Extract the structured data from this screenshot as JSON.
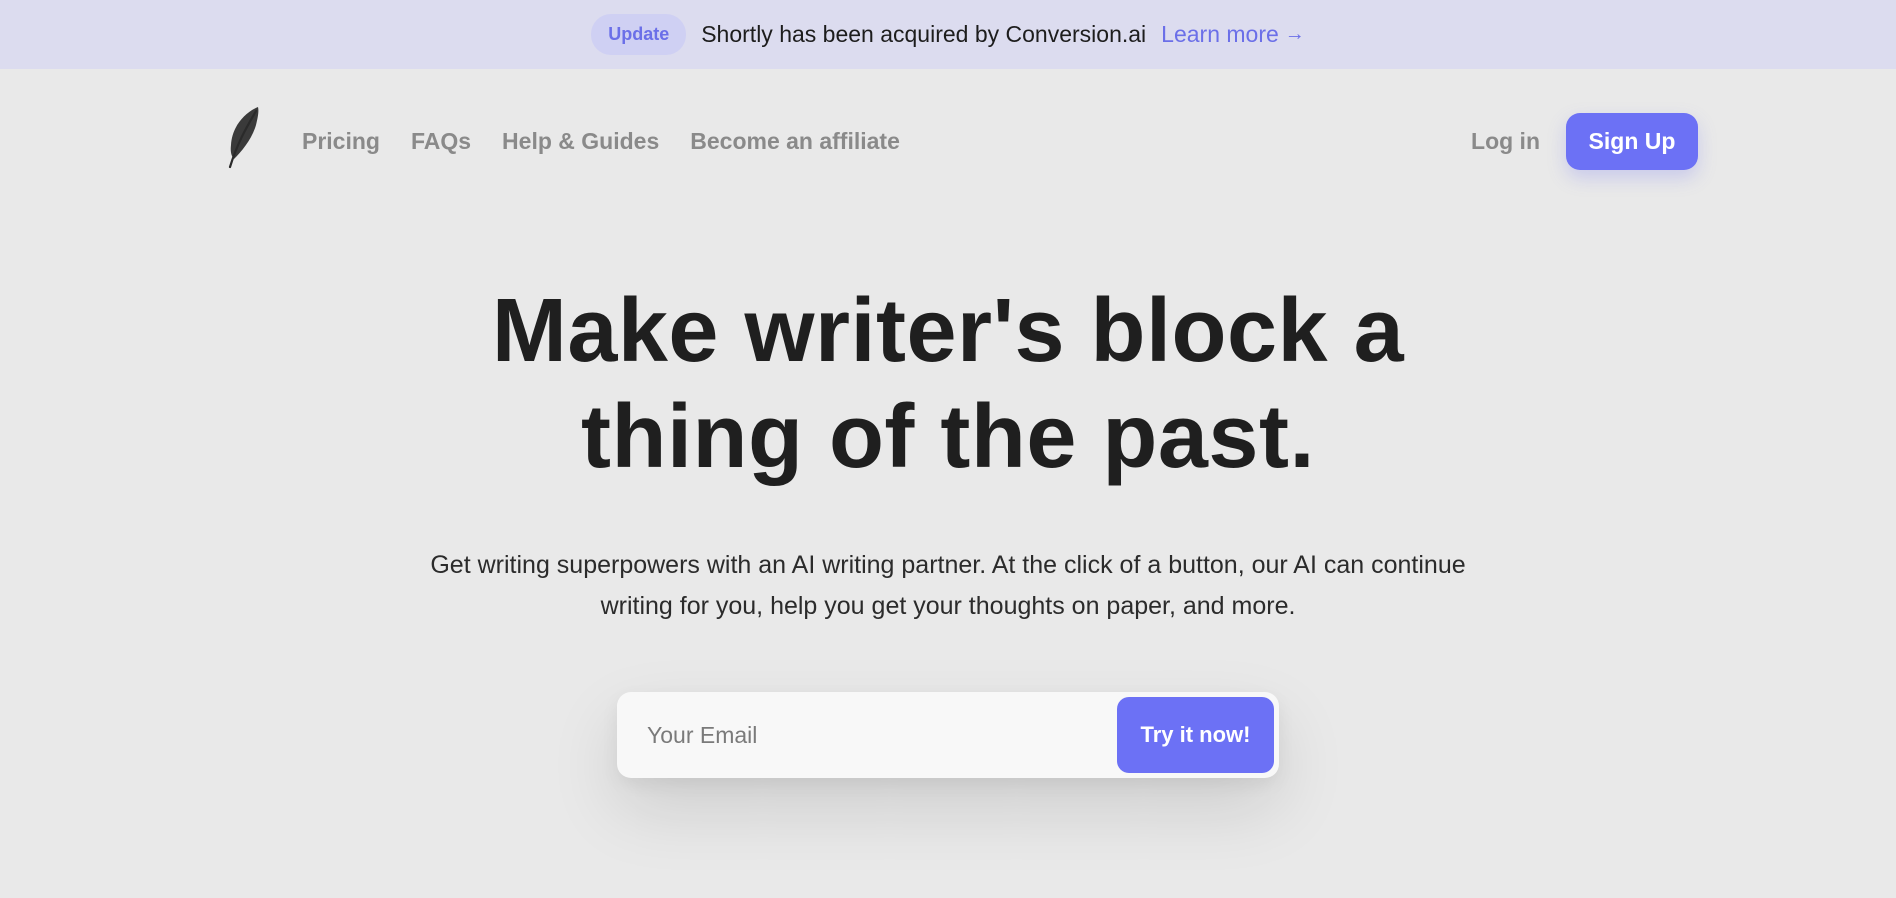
{
  "announcement": {
    "badge": "Update",
    "message": "Shortly has been acquired by Conversion.ai",
    "link_label": "Learn more",
    "link_arrow": "→"
  },
  "nav": {
    "logo_icon": "feather-icon",
    "links": [
      "Pricing",
      "FAQs",
      "Help & Guides",
      "Become an affiliate"
    ],
    "login_label": "Log in",
    "signup_label": "Sign Up"
  },
  "hero": {
    "headline_line1": "Make writer's block a",
    "headline_line2": "thing of the past.",
    "subtext_line1": "Get writing superpowers with an AI writing partner. At the click of a button, our AI can continue",
    "subtext_line2": "writing for you, help you get your thoughts on paper, and more."
  },
  "signup_form": {
    "email_placeholder": "Your Email",
    "email_value": "",
    "cta_label": "Try it now!"
  },
  "colors": {
    "accent": "#6c71f5",
    "banner_bg": "#dcdcef",
    "page_bg": "#e9e9e9",
    "nav_text": "#8a8a8a",
    "headline": "#1f1f1f"
  }
}
